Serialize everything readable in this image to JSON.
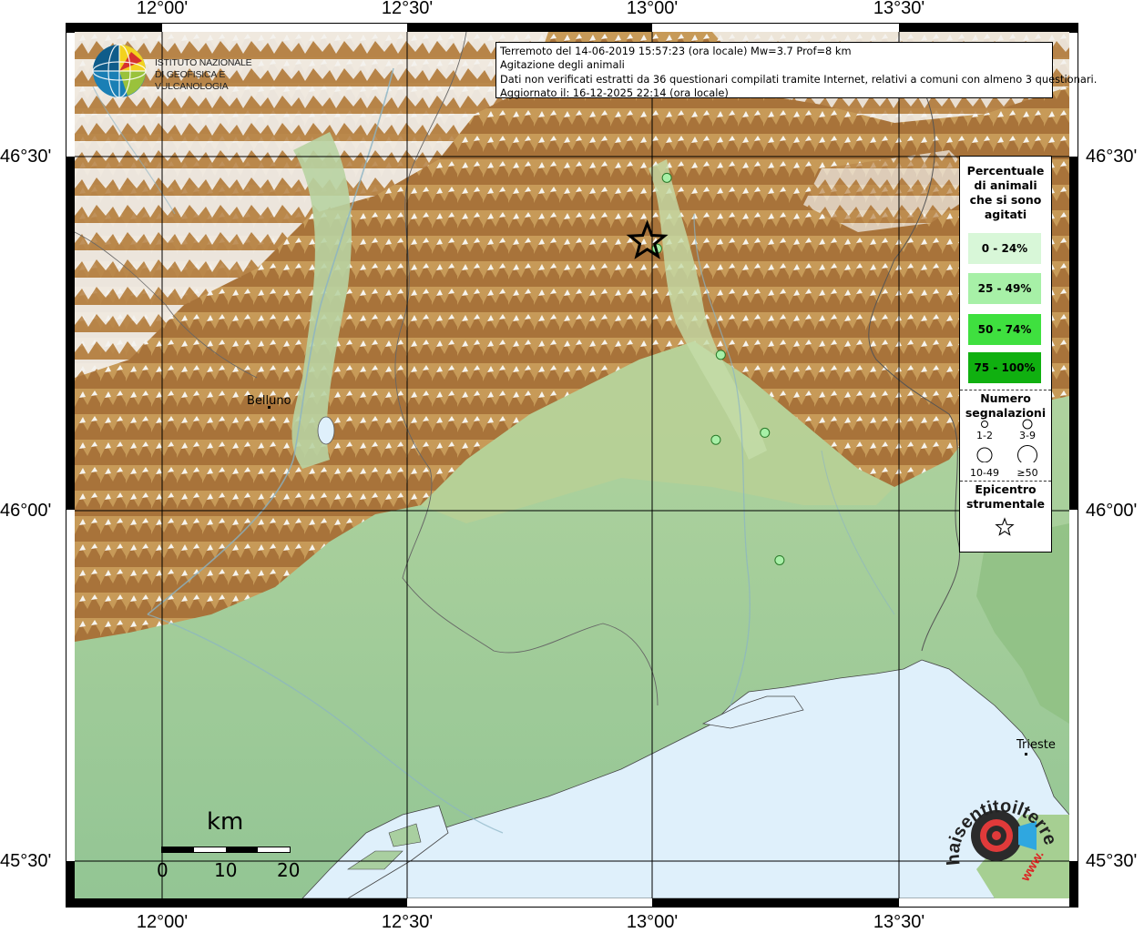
{
  "map": {
    "coordinates": {
      "lon_ticks": [
        "12°00'",
        "12°30'",
        "13°00'",
        "13°30'"
      ],
      "lat_ticks": [
        "46°30'",
        "46°00'",
        "45°30'"
      ]
    },
    "cities": [
      {
        "name": "Belluno"
      },
      {
        "name": "Trieste"
      }
    ],
    "epicenter": {
      "lat": 46.38,
      "lon": 12.99,
      "icon": "star-icon"
    },
    "observations": [
      {
        "lat": 46.47,
        "lon": 13.03,
        "class": "25 - 49%"
      },
      {
        "lat": 46.37,
        "lon": 13.01,
        "class": "25 - 49%"
      },
      {
        "lat": 46.22,
        "lon": 13.14,
        "class": "25 - 49%"
      },
      {
        "lat": 46.1,
        "lon": 13.13,
        "class": "25 - 49%"
      },
      {
        "lat": 46.11,
        "lon": 13.23,
        "class": "25 - 49%"
      },
      {
        "lat": 45.93,
        "lon": 13.26,
        "class": "25 - 49%"
      }
    ]
  },
  "info": {
    "line1": "Terremoto del 14-06-2019 15:57:23 (ora locale) Mw=3.7 Prof=8 km",
    "line2": "Agitazione degli animali",
    "line3": "Dati non verificati estratti da 36 questionari compilati tramite Internet, relativi a comuni con almeno 3 questionari.",
    "line4": "Aggiornato il: 16-12-2025 22:14 (ora locale)"
  },
  "legend": {
    "title_lines": [
      "Percentuale",
      "di animali",
      "che si sono",
      "agitati"
    ],
    "classes": [
      {
        "label": "0 - 24%",
        "color": "#d8f7d8"
      },
      {
        "label": "25 - 49%",
        "color": "#a7f0a7"
      },
      {
        "label": "50 - 74%",
        "color": "#3fe03f"
      },
      {
        "label": "75 - 100%",
        "color": "#10b010"
      }
    ],
    "count_title_lines": [
      "Numero",
      "segnalazioni"
    ],
    "count_labels": [
      "1-2",
      "3-9",
      "10-49",
      "≥50"
    ],
    "epicenter_title_lines": [
      "Epicentro",
      "strumentale"
    ],
    "epicenter_icon": "star-outline-icon"
  },
  "logos": {
    "ingv_line1": "ISTITUTO NAZIONALE",
    "ingv_line2": "DI GEOFISICA E VULCANOLOGIA",
    "hsit_text": "haisentitoilterremoto.it",
    "hsit_url": "www."
  },
  "scalebar": {
    "unit": "km",
    "labels": [
      "0",
      "10",
      "20"
    ]
  },
  "colors": {
    "sea": "#dff0fb",
    "plain": "#a9cfa0",
    "hills": "#c9b37a",
    "mountains": "#b37f3f",
    "snow": "#f6f6f6",
    "grid": "#000000"
  }
}
